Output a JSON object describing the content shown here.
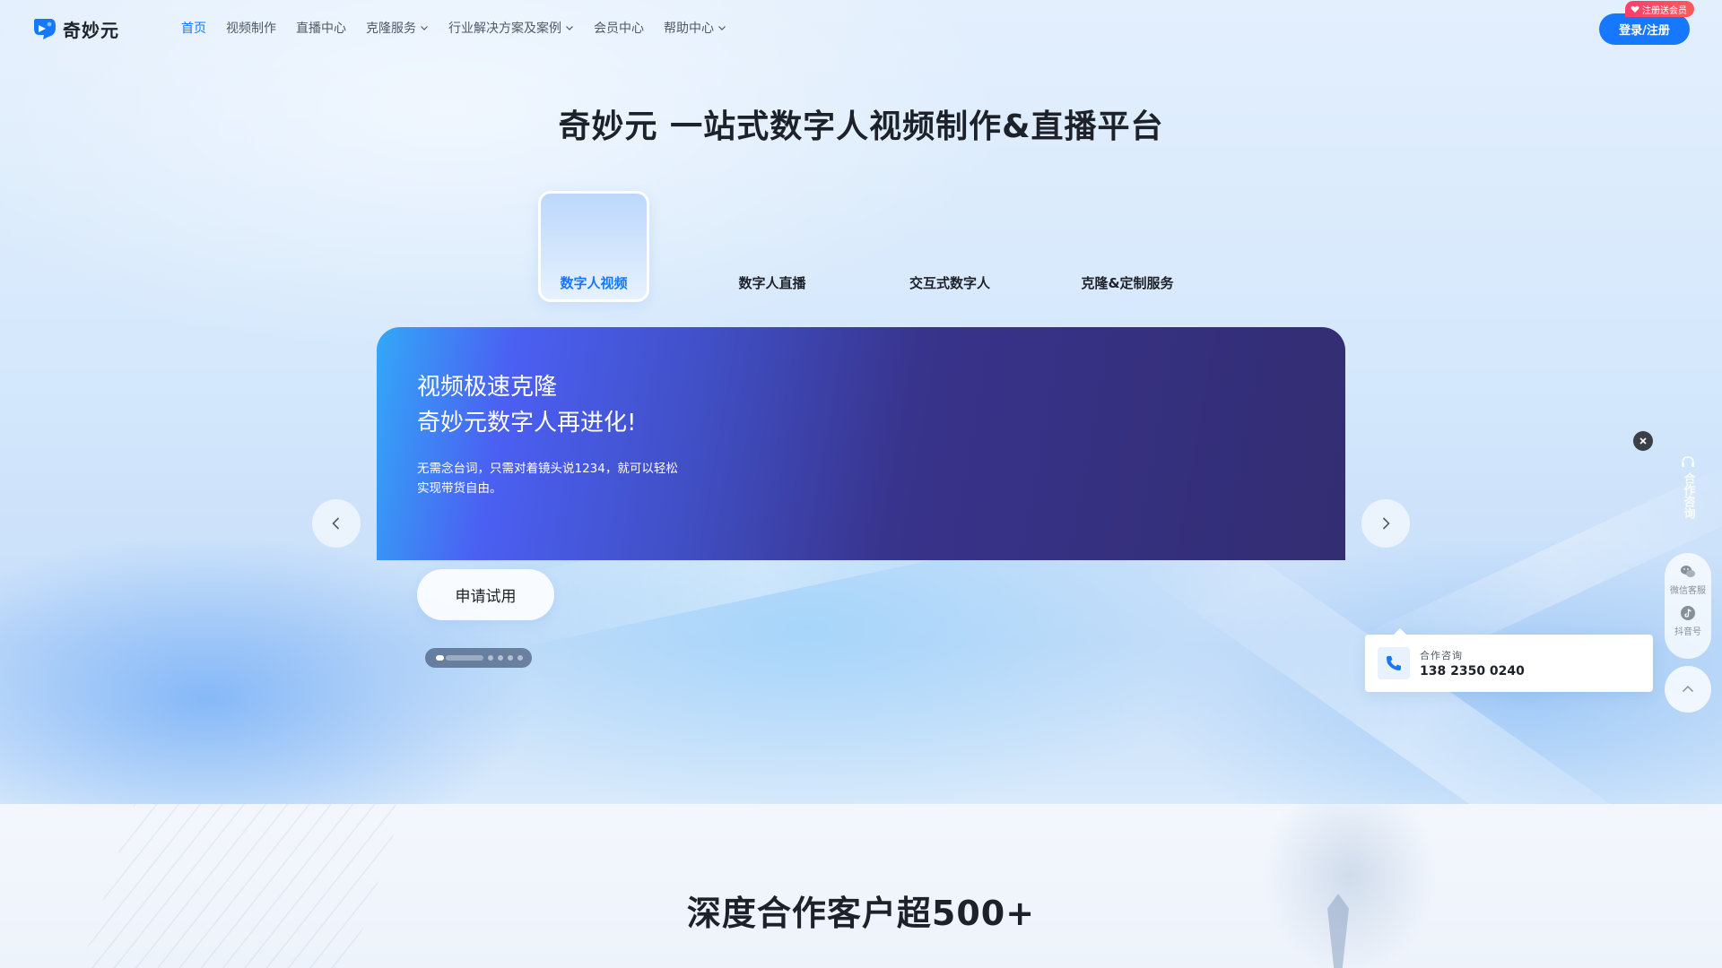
{
  "header": {
    "logo_text": "奇妙元",
    "nav": [
      {
        "label": "首页"
      },
      {
        "label": "视频制作"
      },
      {
        "label": "直播中心"
      },
      {
        "label": "克隆服务"
      },
      {
        "label": "行业解决方案及案例"
      },
      {
        "label": "会员中心"
      },
      {
        "label": "帮助中心"
      }
    ],
    "login_label": "登录/注册",
    "promo_badge": "注册送会员"
  },
  "hero": {
    "title": "奇妙元 一站式数字人视频制作&直播平台",
    "tabs": [
      {
        "label": "数字人视频"
      },
      {
        "label": "数字人直播"
      },
      {
        "label": "交互式数字人"
      },
      {
        "label": "克隆&定制服务"
      }
    ],
    "active_tab": 0
  },
  "banner": {
    "headline_1": "视频极速克隆",
    "headline_2": "奇妙元数字人再进化!",
    "description": "无需念台词，只需对着镜头说1234，就可以轻松实现带货自由。",
    "cta_label": "申请试用",
    "slide_count": 5,
    "active_slide": 0
  },
  "floating": {
    "coop_vertical": "合作咨询",
    "wechat_label": "微信客服",
    "douyin_label": "抖音号",
    "consult_label": "合作咨询",
    "consult_phone": "138 2350 0240"
  },
  "clients": {
    "title": "深度合作客户超500+"
  },
  "colors": {
    "brand": "#1677ff",
    "title_text": "#1d2129",
    "banner_dark": "#332d72",
    "promo": "#ff3d6e"
  },
  "icons": {
    "logo": "qmy-logo-icon",
    "nav_dropdown": "chevron-down-icon",
    "banner_prev": "chevron-left-icon",
    "banner_next": "chevron-right-icon",
    "close": "close-icon",
    "wechat": "wechat-icon",
    "douyin": "douyin-icon",
    "back_to_top": "chevron-up-icon",
    "phone": "phone-icon"
  }
}
